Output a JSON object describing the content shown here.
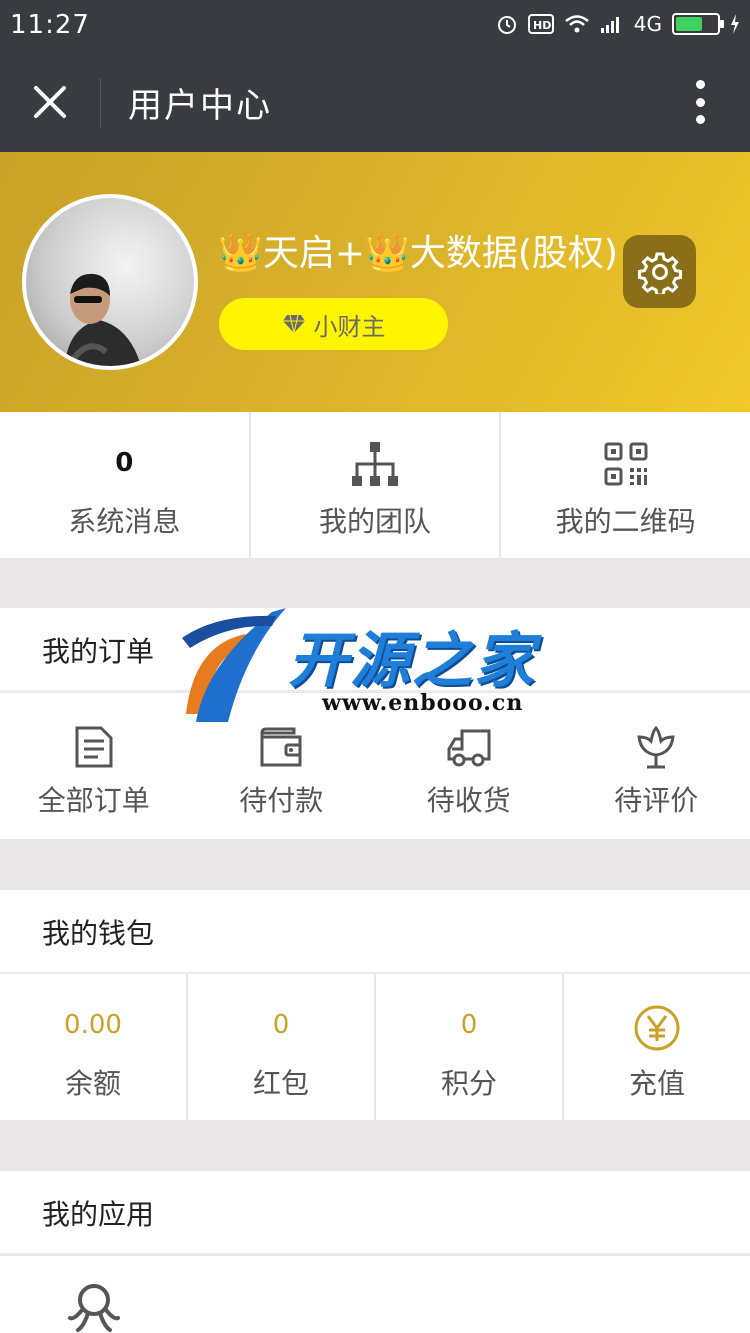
{
  "status_bar": {
    "time": "11:27",
    "network": "4G"
  },
  "title_bar": {
    "title": "用户中心"
  },
  "profile": {
    "username": "👑天启+👑大数据(股权)",
    "level": "小财主"
  },
  "stats": [
    {
      "value": "0",
      "label": "系统消息"
    },
    {
      "icon": "sitemap-icon",
      "label": "我的团队"
    },
    {
      "icon": "qrcode-icon",
      "label": "我的二维码"
    }
  ],
  "orders": {
    "title": "我的订单",
    "items": [
      {
        "icon": "document-icon",
        "label": "全部订单"
      },
      {
        "icon": "wallet-icon",
        "label": "待付款"
      },
      {
        "icon": "truck-icon",
        "label": "待收货"
      },
      {
        "icon": "flower-icon",
        "label": "待评价"
      }
    ]
  },
  "wallet": {
    "title": "我的钱包",
    "items": [
      {
        "value": "0.00",
        "label": "余额"
      },
      {
        "value": "0",
        "label": "红包"
      },
      {
        "value": "0",
        "label": "积分"
      },
      {
        "icon": "yen-icon",
        "label": "充值"
      }
    ]
  },
  "apps": {
    "title": "我的应用"
  },
  "watermark": {
    "brand": "开源之家",
    "url": "www.enbooo.cn"
  },
  "colors": {
    "dark_bar": "#3a3b40",
    "gold": "#c9a227",
    "badge_yellow": "#fff500",
    "settings_bg": "#8a6f18"
  }
}
